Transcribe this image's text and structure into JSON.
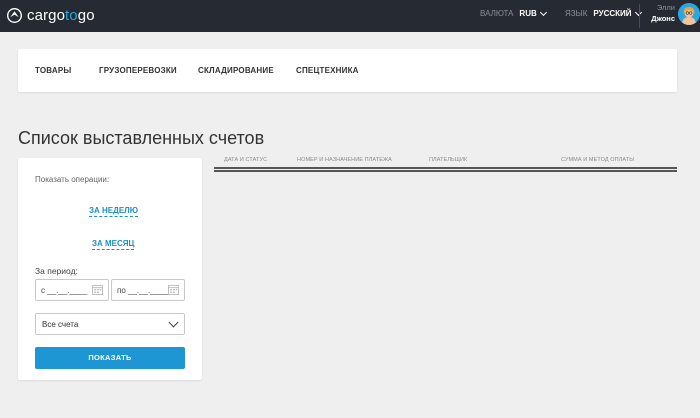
{
  "header": {
    "logo_prefix": "cargo",
    "logo_accent": "to",
    "logo_suffix": "go",
    "currency_label": "ВАЛЮТА",
    "currency_value": "RUB",
    "language_label": "ЯЗЫК",
    "language_value": "РУССКИЙ",
    "user_first": "Элли",
    "user_last": "Джонс"
  },
  "nav": {
    "items": [
      "ТОВАРЫ",
      "ГРУЗОПЕРЕВОЗКИ",
      "СКЛАДИРОВАНИЕ",
      "СПЕЦТЕХНИКА"
    ]
  },
  "page": {
    "title": "Список выставленных счетов"
  },
  "filters": {
    "operations_label": "Показать операции:",
    "week_link": "ЗА НЕДЕЛЮ",
    "month_link": "ЗА МЕСЯЦ",
    "period_label": "За период:",
    "date_from": "с __.__.____",
    "date_to": "по __.__.____",
    "account_select": "Все счета",
    "show_button": "ПОКАЗАТЬ"
  },
  "table": {
    "columns": [
      "ДАТА И СТАТУС",
      "НОМЕР И НАЗНАЧЕНИЕ ПЛАТЕЖА",
      "ПЛАТЕЛЬЩИК",
      "СУММА И МЕТОД ОПЛАТЫ"
    ]
  },
  "colors": {
    "topbar": "#262b33",
    "accent": "#2aa7de",
    "button": "#1d96d3",
    "background": "#efefef"
  }
}
